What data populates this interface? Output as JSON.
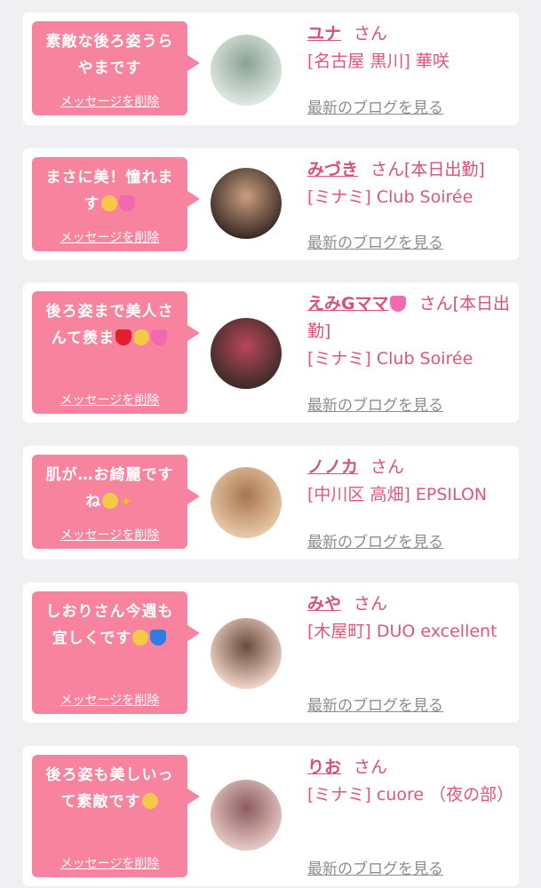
{
  "delete_label": "メッセージを削除",
  "blog_label": "最新のブログを見る",
  "items": [
    {
      "message": "素敵な後ろ姿うらやまです",
      "name": "ユナ",
      "honorific": "さん",
      "shop": "[名古屋 黒川] 華咲",
      "avatar_colors": [
        "#dfe8e2",
        "#8aa392"
      ]
    },
    {
      "message": "まさに美！憧れます",
      "emojis": [
        "pleading-face-icon",
        "pink-hearts-icon"
      ],
      "name": "みづき",
      "honorific": "さん[本日出勤]",
      "shop": "[ミナミ] Club Soirée",
      "avatar_colors": [
        "#3a2a26",
        "#c9a07e"
      ]
    },
    {
      "message": "後ろ姿まで美人さんて羨ま",
      "emojis": [
        "red-heart-icon",
        "pleading-face-icon",
        "pink-hearts-icon"
      ],
      "name": "えみGママ",
      "name_emoji": "pink-hearts-icon",
      "honorific": "さん[本日出勤]",
      "shop": "[ミナミ] Club Soirée",
      "avatar_colors": [
        "#3c2c28",
        "#b9465a"
      ]
    },
    {
      "message": "肌が…お綺麗ですね",
      "emojis": [
        "heart-eyes-face-icon",
        "sparkles-icon"
      ],
      "name": "ノノカ",
      "honorific": "さん",
      "shop": "[中川区 高畑] EPSILON",
      "avatar_colors": [
        "#e8c8a8",
        "#a8764e"
      ]
    },
    {
      "message": "しおりさん今週も宜しくです",
      "emojis": [
        "relieved-face-icon",
        "blue-heart-icon"
      ],
      "name": "みや",
      "honorific": "さん",
      "shop": "[木屋町] DUO excellent",
      "avatar_colors": [
        "#f0d4c8",
        "#6a4a3c"
      ]
    },
    {
      "message": "後ろ姿も美しいって素敵です",
      "emojis": [
        "smiling-face-icon"
      ],
      "name": "りお",
      "honorific": "さん",
      "shop": "[ミナミ] cuore （夜の部）",
      "avatar_colors": [
        "#e6c9c4",
        "#8c5a5e"
      ]
    }
  ]
}
